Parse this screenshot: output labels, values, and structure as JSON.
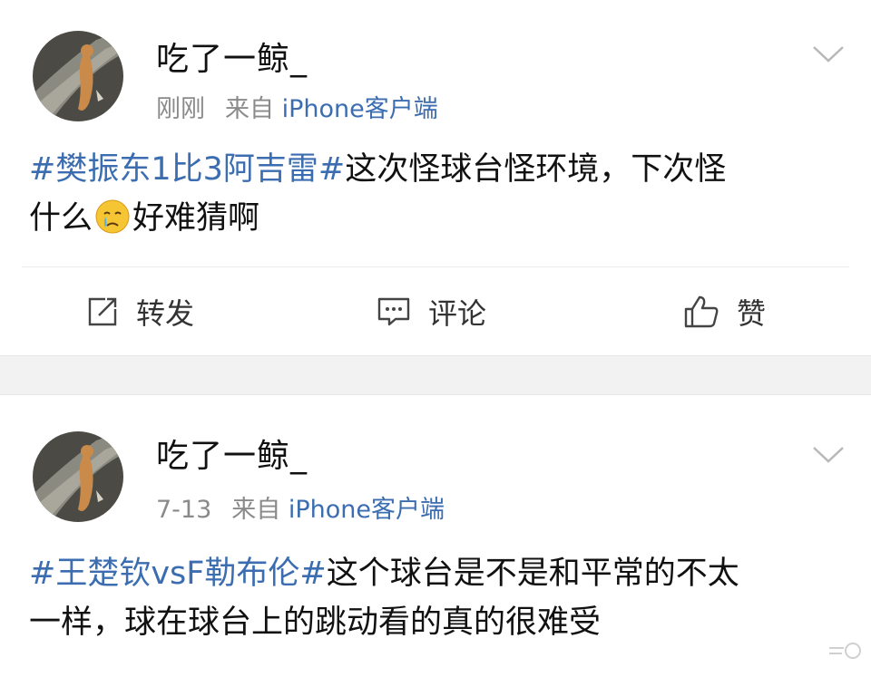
{
  "posts": [
    {
      "username": "吃了一鲸_",
      "time": "刚刚",
      "source_prefix": "来自",
      "source_device": "iPhone客户端",
      "hashtag": "#樊振东1比3阿吉雷#",
      "text_line1_rest": "这次怪球台怪环境，下次怪",
      "text_line2_before_emoji": "什么",
      "emoji": "crying-face-emoji",
      "text_line2_after_emoji": "好难猜啊",
      "actions": {
        "repost": "转发",
        "comment": "评论",
        "like": "赞"
      }
    },
    {
      "username": "吃了一鲸_",
      "time": "7-13",
      "source_prefix": "来自",
      "source_device": "iPhone客户端",
      "hashtag": "#王楚钦vsF勒布伦#",
      "text_line1_rest": "这个球台是不是和平常的不太",
      "text_line2": "一样，球在球台上的跳动看的真的很难受"
    }
  ],
  "colors": {
    "link": "#3b6db0",
    "meta": "#8a8a8a",
    "separator": "#f2f2f2"
  },
  "icons": [
    "chevron-down-icon",
    "repost-icon",
    "comment-icon",
    "like-icon",
    "crying-face-emoji"
  ]
}
